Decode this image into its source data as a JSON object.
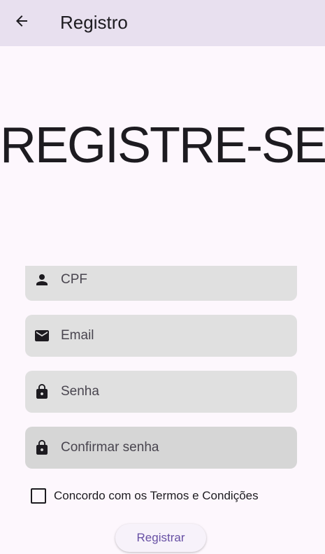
{
  "appbar": {
    "title": "Registro",
    "back_icon": "arrow-back-icon"
  },
  "hero": {
    "heading": "REGISTRE-SE"
  },
  "form": {
    "fields": [
      {
        "placeholder": "CPF",
        "icon": "person-icon"
      },
      {
        "placeholder": "Email",
        "icon": "mail-icon"
      },
      {
        "placeholder": "Senha",
        "icon": "lock-icon"
      },
      {
        "placeholder": "Confirmar senha",
        "icon": "lock-icon"
      }
    ],
    "terms_label": "Concordo com os Termos e Condições",
    "terms_checked": false,
    "submit_label": "Registrar"
  },
  "colors": {
    "appbar_bg": "#e8e0ef",
    "page_bg": "#fdf7fd",
    "field_bg": "#e0e0e0",
    "accent": "#6750a4"
  }
}
